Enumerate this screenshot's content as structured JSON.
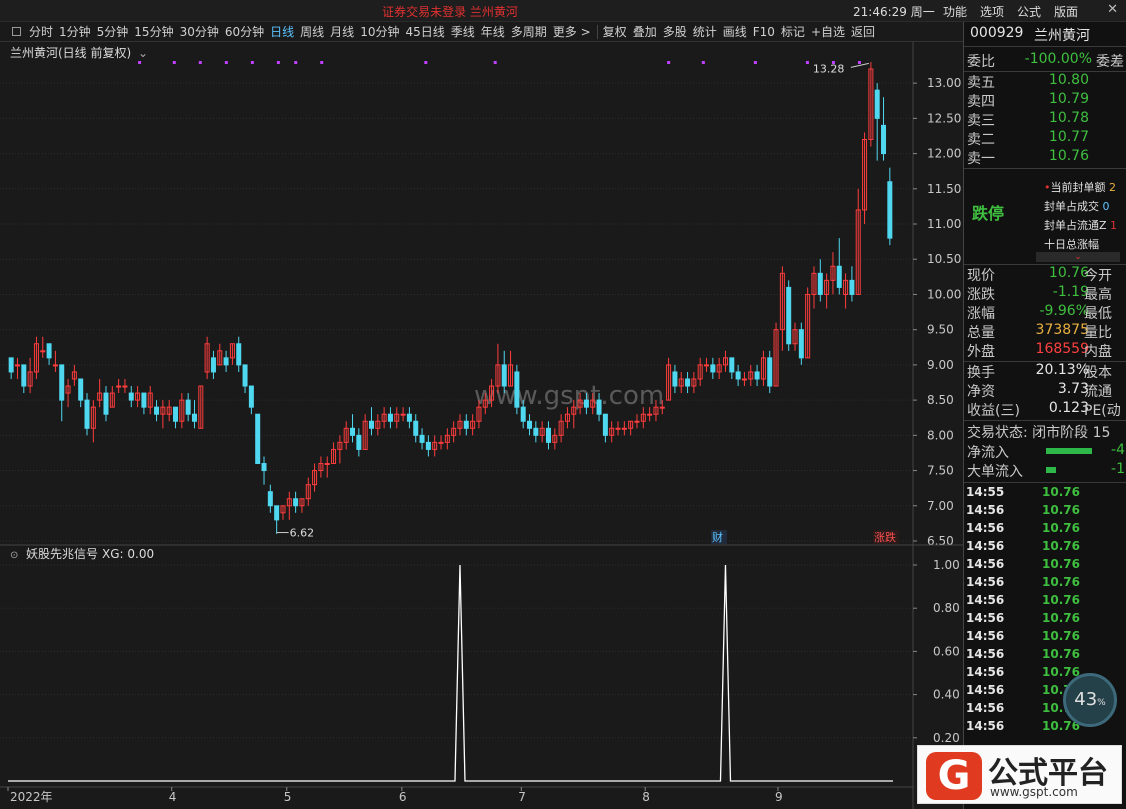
{
  "titlebar": {
    "title": "证券交易未登录  兰州黄河",
    "clock": "21:46:29 周一",
    "menus": [
      "功能",
      "选项",
      "公式",
      "版面"
    ],
    "close": "✕"
  },
  "toolbar": {
    "periods": [
      "分时",
      "1分钟",
      "5分钟",
      "15分钟",
      "30分钟",
      "60分钟",
      "日线",
      "周线",
      "月线",
      "10分钟",
      "45日线",
      "季线",
      "年线",
      "多周期",
      "更多 >"
    ],
    "active": "日线",
    "tools": [
      "复权",
      "叠加",
      "多股",
      "统计",
      "画线",
      "F10",
      "标记",
      "+自选",
      "返回"
    ]
  },
  "main_panel": {
    "label": "兰州黄河(日线 前复权)",
    "dropdown_icon": "⌄",
    "high_label": "13.28",
    "low_label": "6.62",
    "y_ticks": [
      "13.00",
      "12.50",
      "12.00",
      "11.50",
      "11.00",
      "10.50",
      "10.00",
      "9.50",
      "9.00",
      "8.50",
      "8.00",
      "7.50",
      "7.00",
      "6.50"
    ],
    "x_labels": [
      "2022年",
      "4",
      "5",
      "6",
      "7",
      "8",
      "9"
    ],
    "badge_cai": "财",
    "badge_tie": "涨跌",
    "watermark": "www.gspt.com"
  },
  "indicator_panel": {
    "label": "妖股先兆信号",
    "value_label": "XG: 0.00",
    "y_ticks": [
      "1.00",
      "0.80",
      "0.60",
      "0.40",
      "0.20"
    ]
  },
  "colors": {
    "up": "#ff3d3d",
    "down": "#4fd8f0",
    "bg": "#1a1a1a",
    "grid": "#2d2d2d",
    "marker": "#c040ff"
  },
  "chart_data": {
    "type": "candlestick",
    "ylim": [
      6.5,
      13.3
    ],
    "candles": [
      [
        9.1,
        9.1,
        8.8,
        8.9
      ],
      [
        9.0,
        9.1,
        8.8,
        9.0
      ],
      [
        9.0,
        9.0,
        8.6,
        8.7
      ],
      [
        8.7,
        9.1,
        8.6,
        8.9
      ],
      [
        8.9,
        9.4,
        8.8,
        9.3
      ],
      [
        9.2,
        9.4,
        9.1,
        9.2
      ],
      [
        9.3,
        9.3,
        9.0,
        9.1
      ],
      [
        9.0,
        9.2,
        8.9,
        9.0
      ],
      [
        9.0,
        9.0,
        8.2,
        8.5
      ],
      [
        8.6,
        8.8,
        8.4,
        8.7
      ],
      [
        8.8,
        9.0,
        8.7,
        8.9
      ],
      [
        8.8,
        8.8,
        8.4,
        8.5
      ],
      [
        8.5,
        8.6,
        8.0,
        8.1
      ],
      [
        8.1,
        8.5,
        7.9,
        8.4
      ],
      [
        8.5,
        8.8,
        8.4,
        8.6
      ],
      [
        8.6,
        8.7,
        8.2,
        8.3
      ],
      [
        8.4,
        8.7,
        8.4,
        8.6
      ],
      [
        8.7,
        8.8,
        8.6,
        8.7
      ],
      [
        8.7,
        8.8,
        8.6,
        8.7
      ],
      [
        8.6,
        8.7,
        8.4,
        8.5
      ],
      [
        8.5,
        8.7,
        8.4,
        8.6
      ],
      [
        8.6,
        8.6,
        8.3,
        8.4
      ],
      [
        8.4,
        8.7,
        8.3,
        8.6
      ],
      [
        8.4,
        8.5,
        8.2,
        8.3
      ],
      [
        8.3,
        8.5,
        8.1,
        8.4
      ],
      [
        8.3,
        8.5,
        8.2,
        8.4
      ],
      [
        8.4,
        8.4,
        8.1,
        8.2
      ],
      [
        8.2,
        8.6,
        8.1,
        8.5
      ],
      [
        8.5,
        8.6,
        8.2,
        8.3
      ],
      [
        8.3,
        8.5,
        8.1,
        8.2
      ],
      [
        8.1,
        8.7,
        8.1,
        8.7
      ],
      [
        8.9,
        9.4,
        8.8,
        9.3
      ],
      [
        9.1,
        9.2,
        8.8,
        8.9
      ],
      [
        9.0,
        9.3,
        9.0,
        9.2
      ],
      [
        9.1,
        9.2,
        8.9,
        9.0
      ],
      [
        9.1,
        9.3,
        9.0,
        9.3
      ],
      [
        9.3,
        9.4,
        8.9,
        9.0
      ],
      [
        9.0,
        9.0,
        8.6,
        8.7
      ],
      [
        8.7,
        8.7,
        8.3,
        8.4
      ],
      [
        8.3,
        8.3,
        7.6,
        7.6
      ],
      [
        7.6,
        7.7,
        7.3,
        7.5
      ],
      [
        7.2,
        7.3,
        6.9,
        7.0
      ],
      [
        7.0,
        7.0,
        6.6,
        6.8
      ],
      [
        6.9,
        7.0,
        6.8,
        7.0
      ],
      [
        7.0,
        7.2,
        6.8,
        7.1
      ],
      [
        7.1,
        7.2,
        6.9,
        7.0
      ],
      [
        7.0,
        7.1,
        6.9,
        7.1
      ],
      [
        7.1,
        7.4,
        7.0,
        7.3
      ],
      [
        7.3,
        7.6,
        7.2,
        7.5
      ],
      [
        7.5,
        7.7,
        7.4,
        7.6
      ],
      [
        7.6,
        7.7,
        7.4,
        7.6
      ],
      [
        7.6,
        7.9,
        7.6,
        7.8
      ],
      [
        7.8,
        8.0,
        7.6,
        7.9
      ],
      [
        7.9,
        8.2,
        7.8,
        8.1
      ],
      [
        8.1,
        8.3,
        7.9,
        8.0
      ],
      [
        8.0,
        8.1,
        7.7,
        7.8
      ],
      [
        7.8,
        8.3,
        7.8,
        8.2
      ],
      [
        8.2,
        8.4,
        8.0,
        8.1
      ],
      [
        8.1,
        8.3,
        8.0,
        8.2
      ],
      [
        8.2,
        8.4,
        8.1,
        8.3
      ],
      [
        8.3,
        8.4,
        8.1,
        8.2
      ],
      [
        8.2,
        8.4,
        8.1,
        8.3
      ],
      [
        8.3,
        8.4,
        8.2,
        8.3
      ],
      [
        8.3,
        8.4,
        8.1,
        8.2
      ],
      [
        8.2,
        8.3,
        7.9,
        8.0
      ],
      [
        8.0,
        8.1,
        7.8,
        7.9
      ],
      [
        7.9,
        8.0,
        7.7,
        7.8
      ],
      [
        7.8,
        8.0,
        7.7,
        7.9
      ],
      [
        7.9,
        8.0,
        7.8,
        7.9
      ],
      [
        7.9,
        8.1,
        7.8,
        8.0
      ],
      [
        8.0,
        8.2,
        7.9,
        8.1
      ],
      [
        8.1,
        8.3,
        8.0,
        8.2
      ],
      [
        8.2,
        8.3,
        8.0,
        8.1
      ],
      [
        8.1,
        8.3,
        8.0,
        8.2
      ],
      [
        8.2,
        8.5,
        8.1,
        8.4
      ],
      [
        8.4,
        8.6,
        8.3,
        8.5
      ],
      [
        8.5,
        8.8,
        8.4,
        8.7
      ],
      [
        8.7,
        9.3,
        8.6,
        9.0
      ],
      [
        9.0,
        9.2,
        8.6,
        8.7
      ],
      [
        8.7,
        9.2,
        8.7,
        9.0
      ],
      [
        8.9,
        9.0,
        8.3,
        8.4
      ],
      [
        8.4,
        8.5,
        8.1,
        8.2
      ],
      [
        8.2,
        8.3,
        8.0,
        8.1
      ],
      [
        8.1,
        8.2,
        7.9,
        8.0
      ],
      [
        8.0,
        8.2,
        7.9,
        8.1
      ],
      [
        8.1,
        8.2,
        7.8,
        7.9
      ],
      [
        7.9,
        8.1,
        7.8,
        8.0
      ],
      [
        8.0,
        8.3,
        7.9,
        8.2
      ],
      [
        8.2,
        8.4,
        8.1,
        8.3
      ],
      [
        8.3,
        8.5,
        8.1,
        8.4
      ],
      [
        8.4,
        8.6,
        8.3,
        8.5
      ],
      [
        8.5,
        8.6,
        8.3,
        8.4
      ],
      [
        8.4,
        8.6,
        8.3,
        8.5
      ],
      [
        8.5,
        8.6,
        8.2,
        8.3
      ],
      [
        8.3,
        8.3,
        7.9,
        8.0
      ],
      [
        8.0,
        8.2,
        7.9,
        8.1
      ],
      [
        8.1,
        8.2,
        8.0,
        8.1
      ],
      [
        8.1,
        8.2,
        8.0,
        8.1
      ],
      [
        8.1,
        8.2,
        8.0,
        8.2
      ],
      [
        8.2,
        8.3,
        8.1,
        8.2
      ],
      [
        8.2,
        8.4,
        8.1,
        8.3
      ],
      [
        8.3,
        8.4,
        8.2,
        8.3
      ],
      [
        8.3,
        8.5,
        8.2,
        8.4
      ],
      [
        8.4,
        8.5,
        8.3,
        8.4
      ],
      [
        8.5,
        9.1,
        8.5,
        9.0
      ],
      [
        8.9,
        9.0,
        8.6,
        8.7
      ],
      [
        8.7,
        8.9,
        8.6,
        8.8
      ],
      [
        8.8,
        8.9,
        8.6,
        8.7
      ],
      [
        8.7,
        8.9,
        8.6,
        8.8
      ],
      [
        8.8,
        9.1,
        8.7,
        9.0
      ],
      [
        9.0,
        9.1,
        8.9,
        9.0
      ],
      [
        9.0,
        9.1,
        8.8,
        8.9
      ],
      [
        8.9,
        9.1,
        8.8,
        9.0
      ],
      [
        9.0,
        9.2,
        8.9,
        9.1
      ],
      [
        9.1,
        9.1,
        8.8,
        8.9
      ],
      [
        8.9,
        9.0,
        8.7,
        8.8
      ],
      [
        8.8,
        8.9,
        8.7,
        8.8
      ],
      [
        8.8,
        9.0,
        8.7,
        8.9
      ],
      [
        8.9,
        9.0,
        8.7,
        8.8
      ],
      [
        8.8,
        9.2,
        8.7,
        9.1
      ],
      [
        9.1,
        9.2,
        8.6,
        8.7
      ],
      [
        8.7,
        9.6,
        8.7,
        9.5
      ],
      [
        9.5,
        10.4,
        9.2,
        10.3
      ],
      [
        10.1,
        10.2,
        9.2,
        9.3
      ],
      [
        9.3,
        9.6,
        9.2,
        9.5
      ],
      [
        9.5,
        9.6,
        9.0,
        9.1
      ],
      [
        9.1,
        10.1,
        9.1,
        10.0
      ],
      [
        10.0,
        10.4,
        9.8,
        10.3
      ],
      [
        10.3,
        10.5,
        9.9,
        10.0
      ],
      [
        10.0,
        10.3,
        9.8,
        10.2
      ],
      [
        10.2,
        10.6,
        10.0,
        10.4
      ],
      [
        10.4,
        10.8,
        10.0,
        10.1
      ],
      [
        10.0,
        10.3,
        9.8,
        10.2
      ],
      [
        10.2,
        10.4,
        9.9,
        10.0
      ],
      [
        10.0,
        11.5,
        10.0,
        11.2
      ],
      [
        11.2,
        12.3,
        11.0,
        12.2
      ],
      [
        12.2,
        13.3,
        12.1,
        13.2
      ],
      [
        12.9,
        13.0,
        11.9,
        12.5
      ],
      [
        12.4,
        12.8,
        11.9,
        12.0
      ],
      [
        11.6,
        11.8,
        10.7,
        10.8
      ]
    ],
    "high_marker": 13.28,
    "low_marker": 6.62,
    "signal_spikes": [
      {
        "candle_index": 71,
        "value": 1.0
      },
      {
        "candle_index": 113,
        "value": 1.0
      }
    ]
  },
  "quote": {
    "code": "000929",
    "name": "兰州黄河",
    "weibi_label": "委比",
    "weibi_value": "-100.00%",
    "weicha_label": "委差",
    "asks": [
      {
        "label": "卖五",
        "price": "10.80"
      },
      {
        "label": "卖四",
        "price": "10.79"
      },
      {
        "label": "卖三",
        "price": "10.78"
      },
      {
        "label": "卖二",
        "price": "10.77"
      },
      {
        "label": "卖一",
        "price": "10.76"
      }
    ],
    "limit_status": "跌停",
    "limit_rows": [
      "当前封单额",
      "封单占成交",
      "封单占流通Z",
      "十日总涨幅"
    ],
    "limit_row_tails": [
      "2",
      "0",
      "1",
      ""
    ],
    "stats": [
      {
        "label": "现价",
        "value": "10.76",
        "cls": "green",
        "tail": "今开"
      },
      {
        "label": "涨跌",
        "value": "-1.19",
        "cls": "green",
        "tail": "最高"
      },
      {
        "label": "涨幅",
        "value": "-9.96%",
        "cls": "green",
        "tail": "最低"
      },
      {
        "label": "总量",
        "value": "373875",
        "cls": "orange",
        "tail": "量比"
      },
      {
        "label": "外盘",
        "value": "168559",
        "cls": "red",
        "tail": "内盘"
      },
      {
        "label": "换手",
        "value": "20.13%",
        "cls": "white",
        "tail": "股本"
      },
      {
        "label": "净资",
        "value": "3.73",
        "cls": "white",
        "tail": "流通"
      },
      {
        "label": "收益(三)",
        "value": "0.123",
        "cls": "white",
        "tail": "PE(动"
      }
    ],
    "trade_state": "交易状态: 闭市阶段 15",
    "netflow_label": "净流入",
    "netflow_value": "-4",
    "bigflow_label": "大单流入",
    "bigflow_value": "-1",
    "ticks": [
      {
        "time": "14:55",
        "price": "10.76"
      },
      {
        "time": "14:56",
        "price": "10.76"
      },
      {
        "time": "14:56",
        "price": "10.76"
      },
      {
        "time": "14:56",
        "price": "10.76"
      },
      {
        "time": "14:56",
        "price": "10.76"
      },
      {
        "time": "14:56",
        "price": "10.76"
      },
      {
        "time": "14:56",
        "price": "10.76"
      },
      {
        "time": "14:56",
        "price": "10.76"
      },
      {
        "time": "14:56",
        "price": "10.76"
      },
      {
        "time": "14:56",
        "price": "10.76"
      },
      {
        "time": "14:56",
        "price": "10.76"
      },
      {
        "time": "14:56",
        "price": "10.76"
      },
      {
        "time": "14:56",
        "price": "10.76"
      },
      {
        "time": "14:56",
        "price": "10.76"
      }
    ],
    "gauge": "43",
    "gauge_unit": "%"
  },
  "logo": {
    "badge": "G",
    "name": "公式平台",
    "url": "www.gspt.com"
  }
}
